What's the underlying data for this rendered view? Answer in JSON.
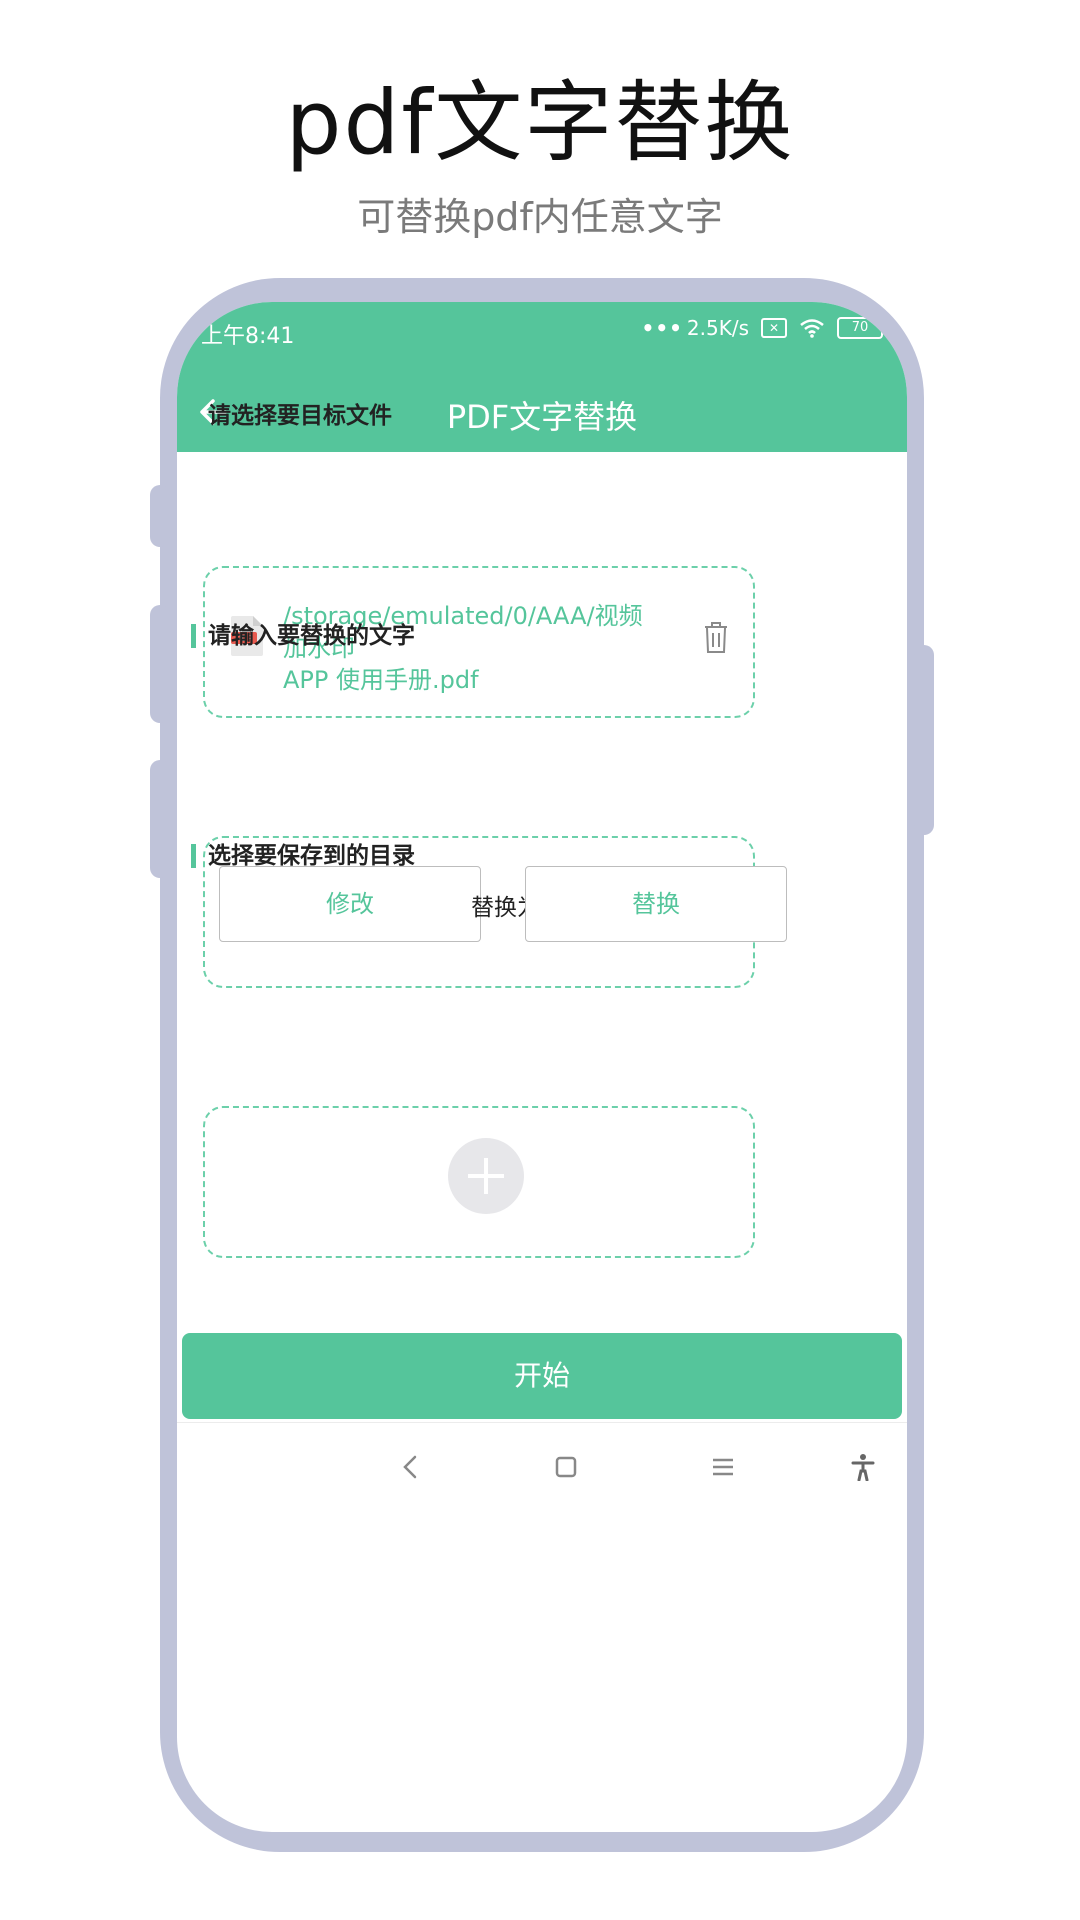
{
  "hero": {
    "title": "pdf文字替换",
    "subtitle": "可替换pdf内任意文字"
  },
  "status_bar": {
    "time": "上午8:41",
    "speed": "2.5K/s",
    "battery": "70"
  },
  "app_bar": {
    "title": "PDF文字替换"
  },
  "sections": {
    "file": {
      "label": "请选择要目标文件",
      "path_line1": "/storage/emulated/0/AAA/视频加水印",
      "path_line2": "APP 使用手册.pdf"
    },
    "text": {
      "label": "请输入要替换的文字",
      "find_value": "修改",
      "replace_label": "替换为",
      "replace_value": "替换"
    },
    "directory": {
      "label": "选择要保存到的目录"
    }
  },
  "actions": {
    "start_label": "开始"
  },
  "colors": {
    "accent": "#55c59b",
    "frame": "#bfc3d9"
  }
}
